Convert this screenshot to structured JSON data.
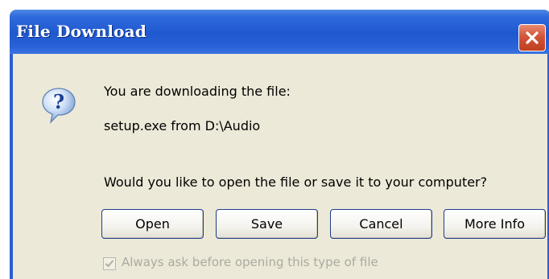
{
  "window": {
    "title": "File Download",
    "close_icon": "close-icon"
  },
  "body": {
    "icon": "question-icon",
    "message_line1": "You are downloading the file:",
    "file_info": "setup.exe from D:\\Audio",
    "question": "Would you like to open the file or save it to your computer?"
  },
  "buttons": {
    "open": "Open",
    "save": "Save",
    "cancel": "Cancel",
    "more_info": "More Info"
  },
  "checkbox": {
    "label": "Always ask before opening this type of file",
    "checked": true,
    "disabled": true
  },
  "colors": {
    "titlebar": "#2a63d8",
    "dialog_bg": "#ece9d8",
    "close_button": "#c0401f",
    "button_border": "#1f3d8c",
    "disabled_text": "#acaaa0"
  }
}
